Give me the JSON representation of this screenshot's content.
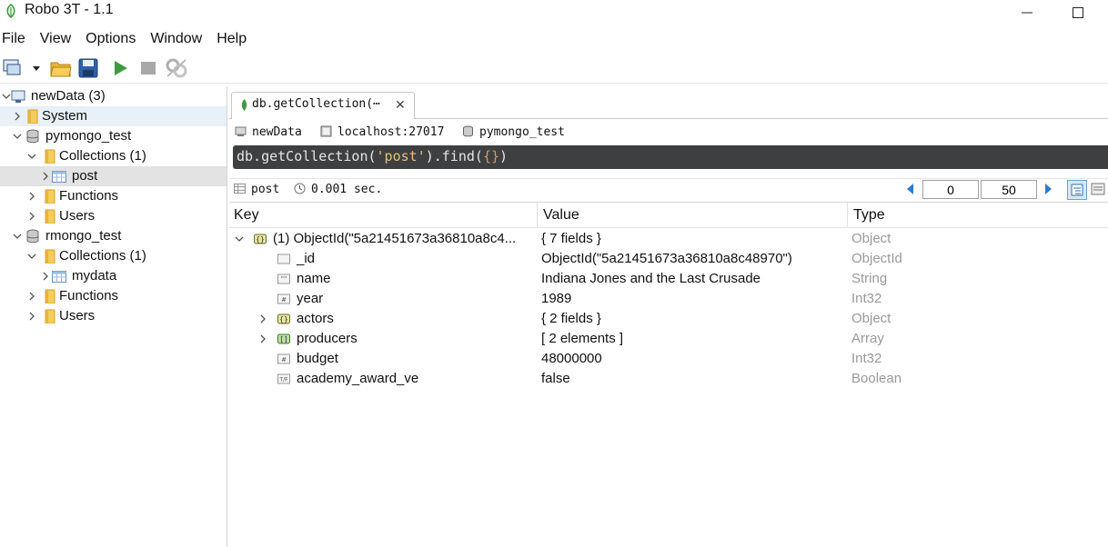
{
  "window": {
    "title": "Robo 3T - 1.1"
  },
  "menu": [
    "File",
    "View",
    "Options",
    "Window",
    "Help"
  ],
  "sidebar": {
    "rows": [
      {
        "label": "newData (3)",
        "level": 0,
        "icon": "server-icon",
        "chevron": "down"
      },
      {
        "label": "System",
        "level": 1,
        "icon": "folder-icon",
        "chevron": "right"
      },
      {
        "label": "pymongo_test",
        "level": 1,
        "icon": "database-icon",
        "chevron": "down"
      },
      {
        "label": "Collections (1)",
        "level": 2,
        "icon": "folder-icon",
        "chevron": "down"
      },
      {
        "label": "post",
        "level": 3,
        "icon": "collection-icon",
        "chevron": "right"
      },
      {
        "label": "Functions",
        "level": 2,
        "icon": "folder-icon",
        "chevron": "right"
      },
      {
        "label": "Users",
        "level": 2,
        "icon": "folder-icon",
        "chevron": "right"
      },
      {
        "label": "rmongo_test",
        "level": 1,
        "icon": "database-icon",
        "chevron": "down"
      },
      {
        "label": "Collections (1)",
        "level": 2,
        "icon": "folder-icon",
        "chevron": "down"
      },
      {
        "label": "mydata",
        "level": 3,
        "icon": "collection-icon",
        "chevron": "right"
      },
      {
        "label": "Functions",
        "level": 2,
        "icon": "folder-icon",
        "chevron": "right"
      },
      {
        "label": "Users",
        "level": 2,
        "icon": "folder-icon",
        "chevron": "right"
      }
    ]
  },
  "tab": {
    "label": "db.getCollection(⋯",
    "close": "✕"
  },
  "info": {
    "connection": "newData",
    "host": "localhost:27017",
    "database": "pymongo_test"
  },
  "query": {
    "prefix": "db.getCollection(",
    "arg": "'post'",
    "mid": ").find(",
    "braces": "{}",
    "suffix": ")"
  },
  "result": {
    "collection": "post",
    "time": "0.001 sec.",
    "skip": "0",
    "limit": "50"
  },
  "grid": {
    "headers": {
      "key": "Key",
      "value": "Value",
      "type": "Type"
    },
    "rows": [
      {
        "key": "(1) ObjectId(\"5a21451673a36810a8c4...",
        "value": "{ 7 fields }",
        "type": "Object",
        "icon": "object-icon",
        "expander": "down",
        "indent": 0
      },
      {
        "key": "_id",
        "value": "ObjectId(\"5a21451673a36810a8c48970\")",
        "type": "ObjectId",
        "icon": "objectid-icon",
        "expander": "none",
        "indent": 1
      },
      {
        "key": "name",
        "value": "Indiana Jones and the Last Crusade",
        "type": "String",
        "icon": "string-icon",
        "expander": "none",
        "indent": 1
      },
      {
        "key": "year",
        "value": "1989",
        "type": "Int32",
        "icon": "int-icon",
        "expander": "none",
        "indent": 1
      },
      {
        "key": "actors",
        "value": "{ 2 fields }",
        "type": "Object",
        "icon": "object-icon",
        "expander": "right",
        "indent": 1
      },
      {
        "key": "producers",
        "value": "[ 2 elements ]",
        "type": "Array",
        "icon": "array-icon",
        "expander": "right",
        "indent": 1
      },
      {
        "key": "budget",
        "value": "48000000",
        "type": "Int32",
        "icon": "int-icon",
        "expander": "none",
        "indent": 1
      },
      {
        "key": "academy_award_ve",
        "value": "false",
        "type": "Boolean",
        "icon": "boolean-icon",
        "expander": "none",
        "indent": 1
      }
    ]
  },
  "colors": {
    "query_bg": "#3d3f41",
    "selected_row": "#e3e3e3",
    "type_text": "#9a9a9a",
    "accent": "#2a7ad2"
  }
}
